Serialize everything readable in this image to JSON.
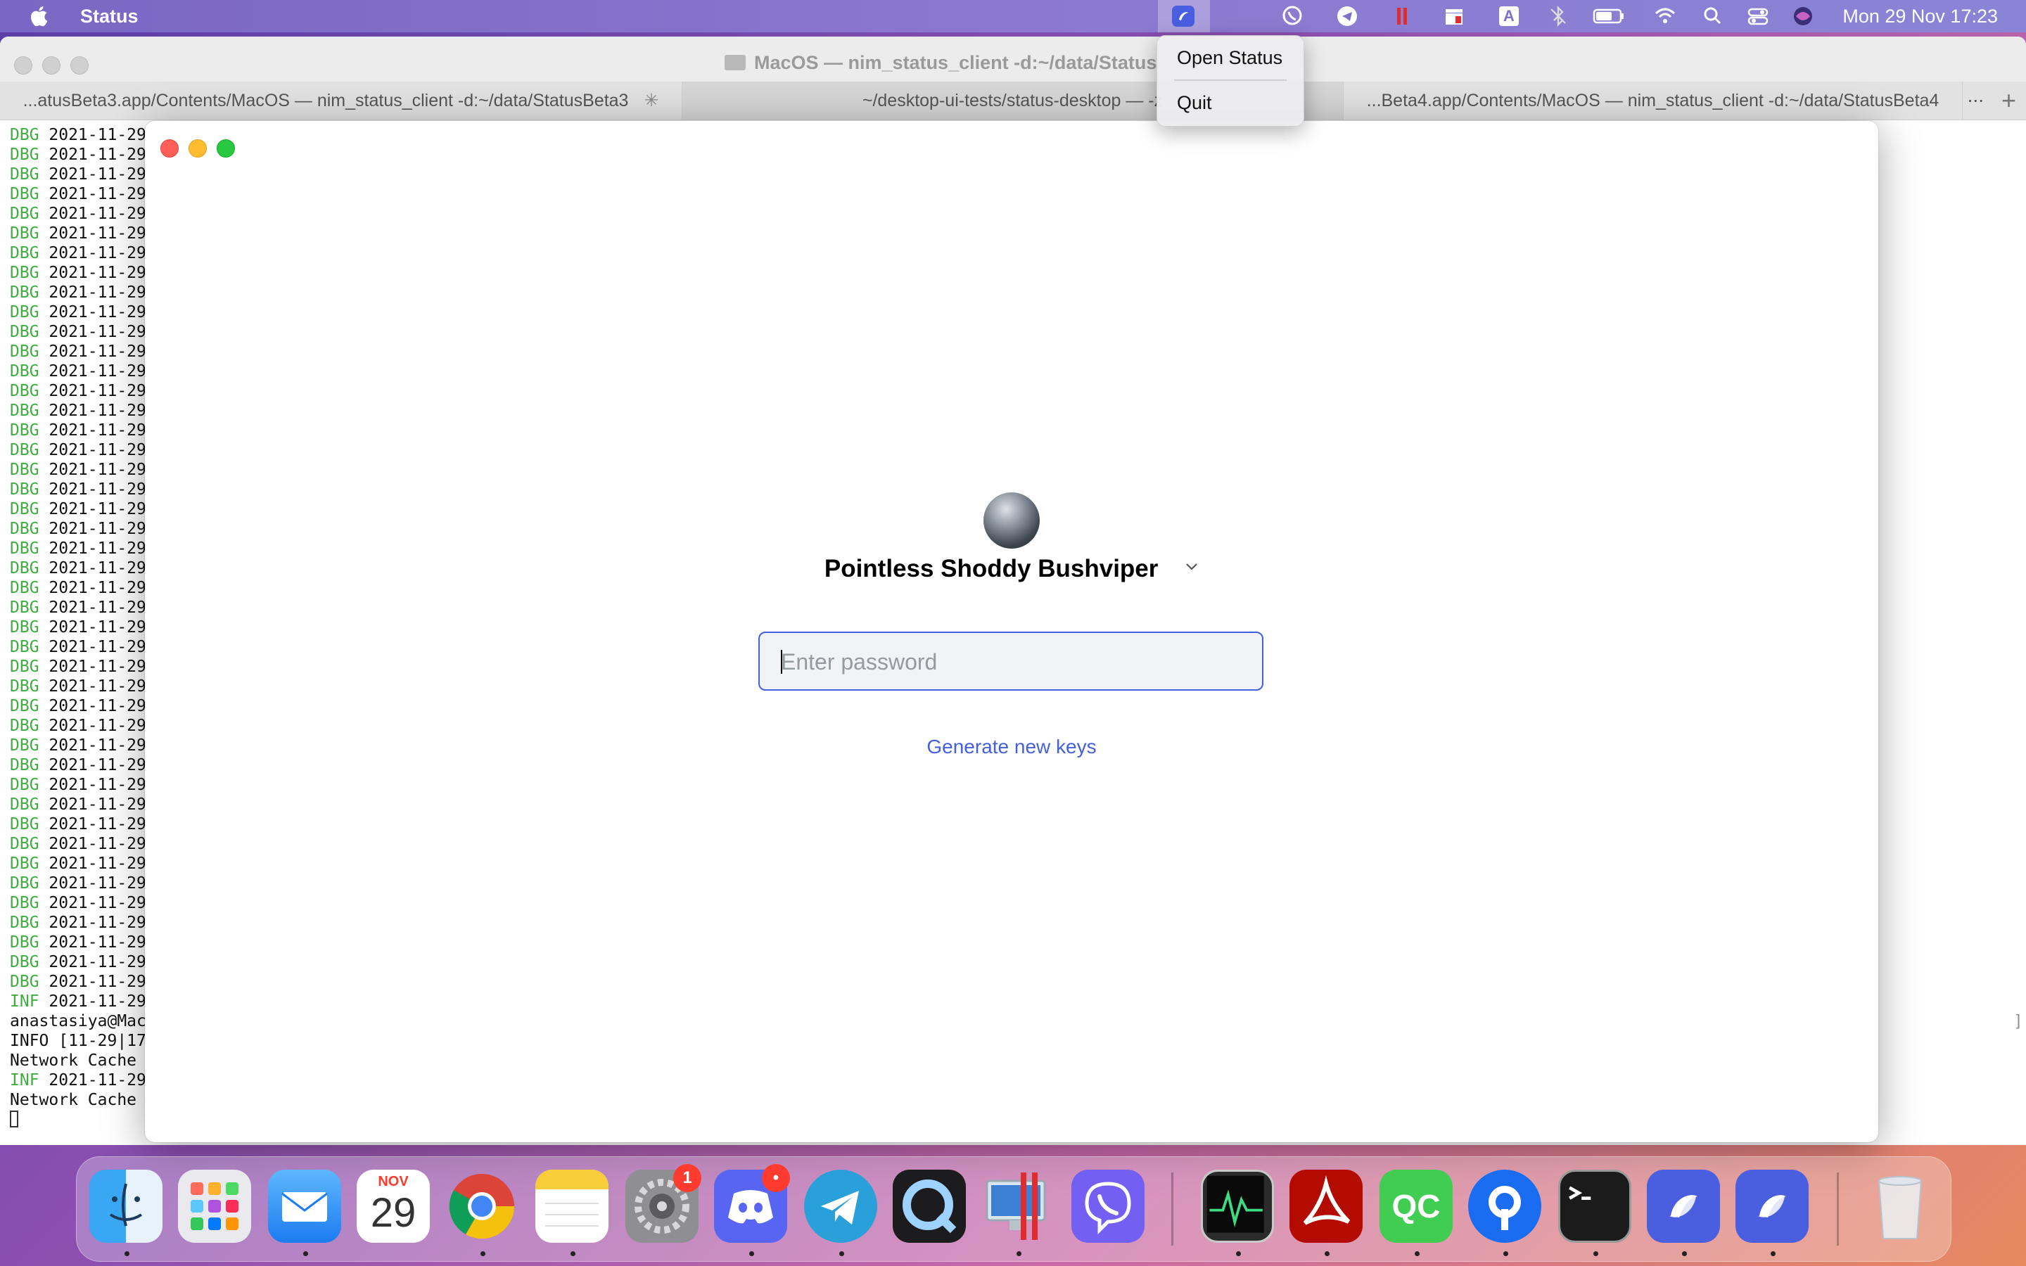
{
  "menubar": {
    "app_name": "Status",
    "clock": "Mon 29 Nov  17:23",
    "icons": [
      "apple-icon",
      "status-tray-icon",
      "viber-tray-icon",
      "telegram-tray-icon",
      "parallels-tray-icon",
      "clapper-tray-icon",
      "input-source-icon",
      "bluetooth-icon",
      "battery-icon",
      "wifi-icon",
      "spotlight-icon",
      "control-center-icon",
      "siri-icon"
    ],
    "input_source_label": "A"
  },
  "tray_menu": {
    "open_label": "Open Status",
    "quit_label": "Quit"
  },
  "terminal": {
    "title": "MacOS — nim_status_client -d:~/data/Status",
    "tabs": [
      {
        "label": "...atusBeta3.app/Contents/MacOS — nim_status_client -d:~/data/StatusBeta3"
      },
      {
        "label": "~/desktop-ui-tests/status-desktop — -z"
      },
      {
        "label": "...Beta4.app/Contents/MacOS — nim_status_client -d:~/data/StatusBeta4"
      }
    ],
    "more_label": "...",
    "plus_label": "+",
    "dbg_level": "DBG",
    "inf_level": "INF",
    "timestamp_fragment": "2021-11-29",
    "dbg_line_count": 44,
    "tail_lines": [
      {
        "level": "INF",
        "text": "2021-11-29"
      },
      {
        "level": "",
        "text": "anastasiya@Mac"
      },
      {
        "level": "",
        "text": "INFO [11-29|17"
      },
      {
        "level": "",
        "text": "Network Cache"
      },
      {
        "level": "INF",
        "text": "2021-11-29"
      },
      {
        "level": "",
        "text": "Network Cache"
      }
    ],
    "right_tick": "]"
  },
  "status_app": {
    "profile_name": "Pointless Shoddy Bushviper",
    "password_placeholder": "Enter password",
    "password_value": "",
    "generate_keys_label": "Generate new keys",
    "accent_color": "#4360df"
  },
  "dock": {
    "apps": [
      "finder",
      "launchpad",
      "mail",
      "calendar",
      "chrome",
      "notes",
      "system-preferences",
      "discord",
      "telegram",
      "quicktime",
      "parallels",
      "viber",
      "activity-monitor",
      "acrobat",
      "qt-creator",
      "pritunl",
      "terminal",
      "status",
      "status-beta",
      "trash"
    ],
    "calendar_month": "NOV",
    "calendar_day": "29",
    "system_prefs_badge": "1",
    "discord_badge": "•"
  }
}
